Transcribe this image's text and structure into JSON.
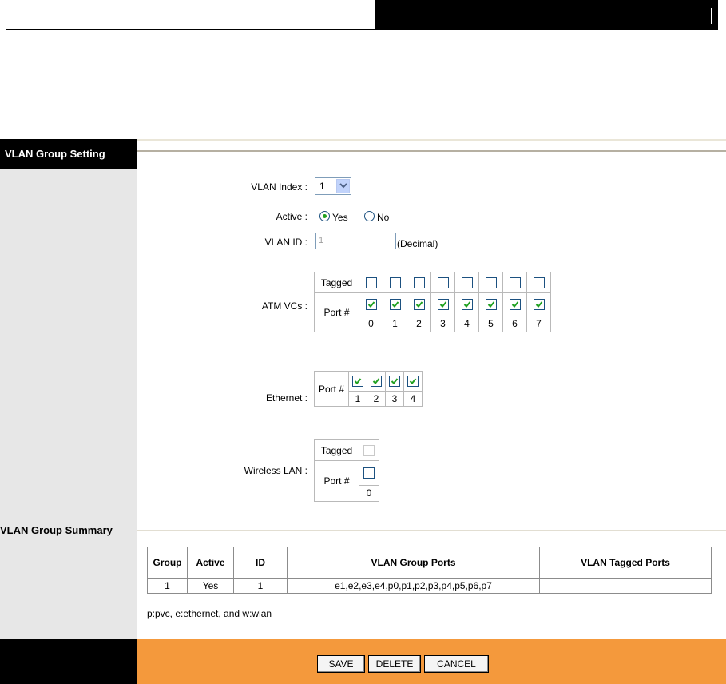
{
  "section1": {
    "title": "VLAN Group Setting"
  },
  "form": {
    "vlan_index": {
      "label": "VLAN Index :",
      "value": "1"
    },
    "active": {
      "label": "Active :",
      "options": [
        "Yes",
        "No"
      ],
      "selected": "Yes"
    },
    "vlan_id": {
      "label": "VLAN ID :",
      "value": "1",
      "unit": "(Decimal)"
    },
    "atm": {
      "label": "ATM VCs :",
      "tagged_label": "Tagged",
      "port_label": "Port #",
      "ports": [
        "0",
        "1",
        "2",
        "3",
        "4",
        "5",
        "6",
        "7"
      ]
    },
    "ethernet": {
      "label": "Ethernet :",
      "port_label": "Port #",
      "ports": [
        "1",
        "2",
        "3",
        "4"
      ]
    },
    "wlan": {
      "label": "Wireless LAN :",
      "tagged_label": "Tagged",
      "port_label": "Port #",
      "ports": [
        "0"
      ]
    }
  },
  "section2": {
    "title": "VLAN Group Summary",
    "headers": [
      "Group",
      "Active",
      "ID",
      "VLAN Group Ports",
      "VLAN Tagged Ports"
    ],
    "rows": [
      {
        "group": "1",
        "active": "Yes",
        "id": "1",
        "ports": "e1,e2,e3,e4,p0,p1,p2,p3,p4,p5,p6,p7",
        "tagged": ""
      }
    ],
    "note": "p:pvc, e:ethernet, and w:wlan"
  },
  "buttons": {
    "save": "SAVE",
    "delete": "DELETE",
    "cancel": "CANCEL"
  },
  "colors": {
    "footer": "#f4993c",
    "check": "#21a121",
    "sidebar": "#e7e7e7"
  }
}
